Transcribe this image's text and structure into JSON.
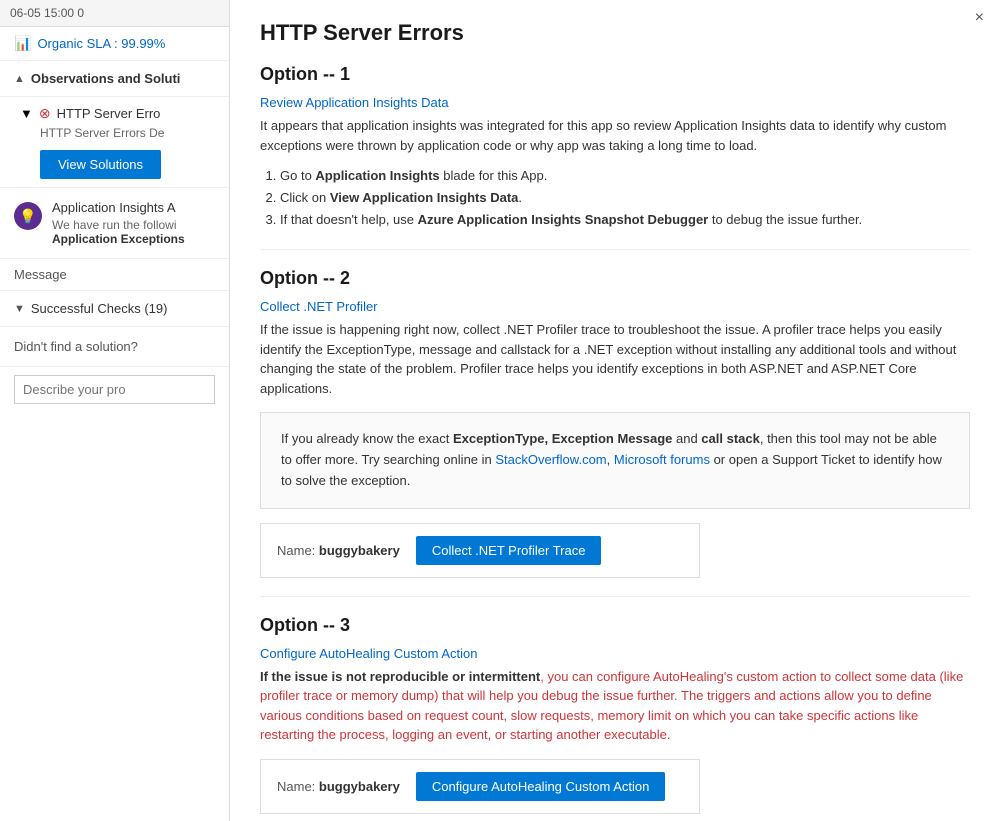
{
  "left": {
    "topbar": "06-05 15:00  0",
    "sla_label": "Organic SLA : 99.99%",
    "observations_section": "Observations and Soluti",
    "http_error_title": "HTTP Server Erro",
    "http_error_desc": "HTTP Server Errors De",
    "view_solutions_btn": "View Solutions",
    "insight_title": "Application Insights A",
    "insight_desc_prefix": "We have run the followi",
    "insight_desc_bold": "Application Exceptions",
    "message_label": "Message",
    "successful_checks": "Successful Checks (19)",
    "no_solution": "Didn't find a solution?",
    "search_placeholder": "Describe your pro"
  },
  "right": {
    "close_btn": "×",
    "panel_title": "HTTP Server Errors",
    "option1": {
      "heading": "Option -- 1",
      "link": "Review Application Insights Data",
      "desc": "It appears that application insights was integrated for this app so review Application Insights data to identify why custom exceptions were thrown by application code or why app was taking a long time to load.",
      "steps": [
        {
          "html": "Go to <b>Application Insights</b> blade for this App."
        },
        {
          "html": "Click on <b>View Application Insights Data</b>."
        },
        {
          "html": "If that doesn't help, use <b>Azure Application Insights Snapshot Debugger</b> to debug the issue further."
        }
      ]
    },
    "option2": {
      "heading": "Option -- 2",
      "link": "Collect .NET Profiler",
      "desc": "If the issue is happening right now, collect .NET Profiler trace to troubleshoot the issue. A profiler trace helps you easily identify the ExceptionType, message and callstack for a .NET exception without installing any additional tools and without changing the state of the problem. Profiler trace helps you identify exceptions in both ASP.NET and ASP.NET Core applications.",
      "callout": {
        "text_before": "If you already know the exact ",
        "bold1": "ExceptionType, Exception Message",
        "text_middle": " and ",
        "bold2": "call stack",
        "text_after": ", then this tool may not be able to offer more. Try searching online in ",
        "link1": "StackOverflow.com",
        "text_comma": ",\n        ",
        "link2": "Microsoft forums",
        "text_end": " or open a Support Ticket to identify how to solve the exception."
      },
      "name_label": "Name:",
      "name_value": "buggybakery",
      "action_btn": "Collect .NET Profiler Trace"
    },
    "option3": {
      "heading": "Option -- 3",
      "link": "Configure AutoHealing Custom Action",
      "desc_bold_part": "If the issue is not reproducible or intermittent",
      "desc_text": ", you can configure AutoHealing's custom action to collect some data (like profiler trace or memory dump) that will help you debug the issue further. The triggers and actions allow you to define various conditions based on request count, slow requests, memory limit on which you can take specific actions like restarting the process, logging an event, or starting another executable.",
      "name_label": "Name:",
      "name_value": "buggybakery",
      "action_btn": "Configure AutoHealing Custom Action"
    }
  }
}
